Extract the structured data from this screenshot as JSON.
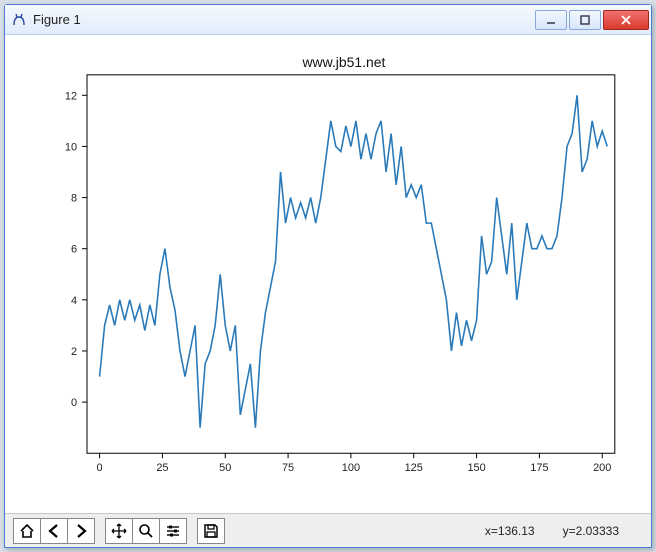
{
  "window": {
    "title": "Figure 1",
    "min_tooltip": "Minimize",
    "max_tooltip": "Maximize",
    "close_tooltip": "Close"
  },
  "chart_data": {
    "type": "line",
    "title": "www.jb51.net",
    "xlabel": "",
    "ylabel": "",
    "x_ticks": [
      0,
      25,
      50,
      75,
      100,
      125,
      150,
      175,
      200
    ],
    "y_ticks": [
      0,
      2,
      4,
      6,
      8,
      10,
      12
    ],
    "xlim": [
      -5,
      205
    ],
    "ylim": [
      -2,
      12.8
    ],
    "x": [
      0,
      2,
      4,
      6,
      8,
      10,
      12,
      14,
      16,
      18,
      20,
      22,
      24,
      26,
      28,
      30,
      32,
      34,
      36,
      38,
      40,
      42,
      44,
      46,
      48,
      50,
      52,
      54,
      56,
      58,
      60,
      62,
      64,
      66,
      68,
      70,
      72,
      74,
      76,
      78,
      80,
      82,
      84,
      86,
      88,
      90,
      92,
      94,
      96,
      98,
      100,
      102,
      104,
      106,
      108,
      110,
      112,
      114,
      116,
      118,
      120,
      122,
      124,
      126,
      128,
      130,
      132,
      134,
      136,
      138,
      140,
      142,
      144,
      146,
      148,
      150,
      152,
      154,
      156,
      158,
      160,
      162,
      164,
      166,
      168,
      170,
      172,
      174,
      176,
      178,
      180,
      182,
      184,
      186,
      188,
      190,
      192,
      194,
      196,
      198,
      200,
      202
    ],
    "values": [
      1,
      3,
      3.8,
      3.0,
      4.0,
      3.2,
      4.0,
      3.2,
      3.8,
      2.8,
      3.8,
      3.0,
      5.0,
      6.0,
      4.5,
      3.6,
      2.0,
      1.0,
      2.0,
      3.0,
      -1.0,
      1.5,
      2.0,
      3.0,
      5.0,
      3.0,
      2.0,
      3.0,
      -0.5,
      0.5,
      1.5,
      -1.0,
      2.0,
      3.5,
      4.5,
      5.5,
      9.0,
      7.0,
      8.0,
      7.2,
      7.8,
      7.2,
      8.0,
      7.0,
      8.0,
      9.5,
      11.0,
      10.0,
      9.8,
      10.8,
      10.0,
      11.0,
      9.5,
      10.5,
      9.5,
      10.5,
      11.0,
      9.0,
      10.5,
      8.5,
      10.0,
      8.0,
      8.5,
      8.0,
      8.5,
      7.0,
      7.0,
      6.0,
      5.0,
      4.0,
      2.0,
      3.5,
      2.2,
      3.2,
      2.4,
      3.2,
      6.5,
      5.0,
      5.5,
      8.0,
      6.5,
      5.0,
      7.0,
      4.0,
      5.5,
      7.0,
      6.0,
      6.0,
      6.5,
      6.0,
      6.0,
      6.5,
      8.0,
      10.0,
      10.5,
      12.0,
      9.0,
      9.5,
      11.0,
      10.0,
      10.6,
      10.0
    ]
  },
  "toolbar": {
    "home": "Home",
    "back": "Back",
    "forward": "Forward",
    "pan": "Pan",
    "zoom": "Zoom",
    "configure": "Configure subplots",
    "save": "Save"
  },
  "status": {
    "x_label": "x=136.13",
    "y_label": "y=2.03333"
  }
}
